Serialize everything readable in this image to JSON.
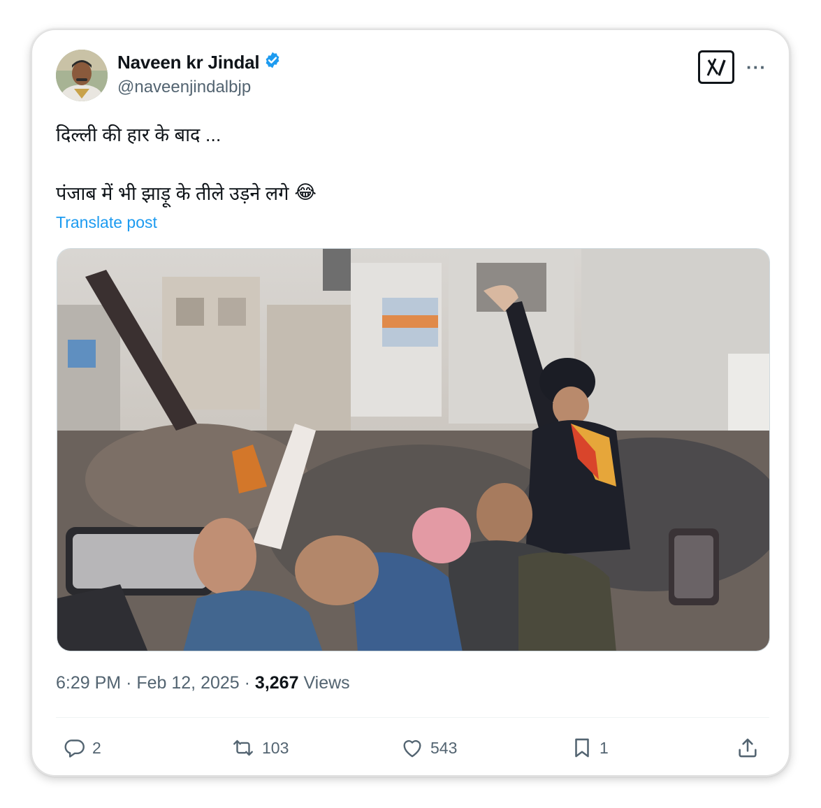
{
  "author": {
    "name": "Naveen kr Jindal",
    "handle": "@naveenjindalbjp",
    "verified": true
  },
  "post": {
    "line1": "दिल्ली की हार के बाद ...",
    "line2": "पंजाब में भी झाड़ू के तीले उड़ने लगे",
    "emoji": "😂",
    "translate_label": "Translate post"
  },
  "meta": {
    "time": "6:29 PM",
    "date": "Feb 12, 2025",
    "views_count": "3,267",
    "views_label": "Views",
    "separator": "·"
  },
  "actions": {
    "replies": "2",
    "reposts": "103",
    "likes": "543",
    "bookmarks": "1"
  },
  "icons": [
    "verified-badge-icon",
    "grok-x-icon",
    "more-icon",
    "reply-icon",
    "repost-icon",
    "like-icon",
    "bookmark-icon",
    "share-icon"
  ],
  "colors": {
    "accent": "#1d9bf0",
    "muted": "#536471",
    "text": "#0f1419"
  }
}
